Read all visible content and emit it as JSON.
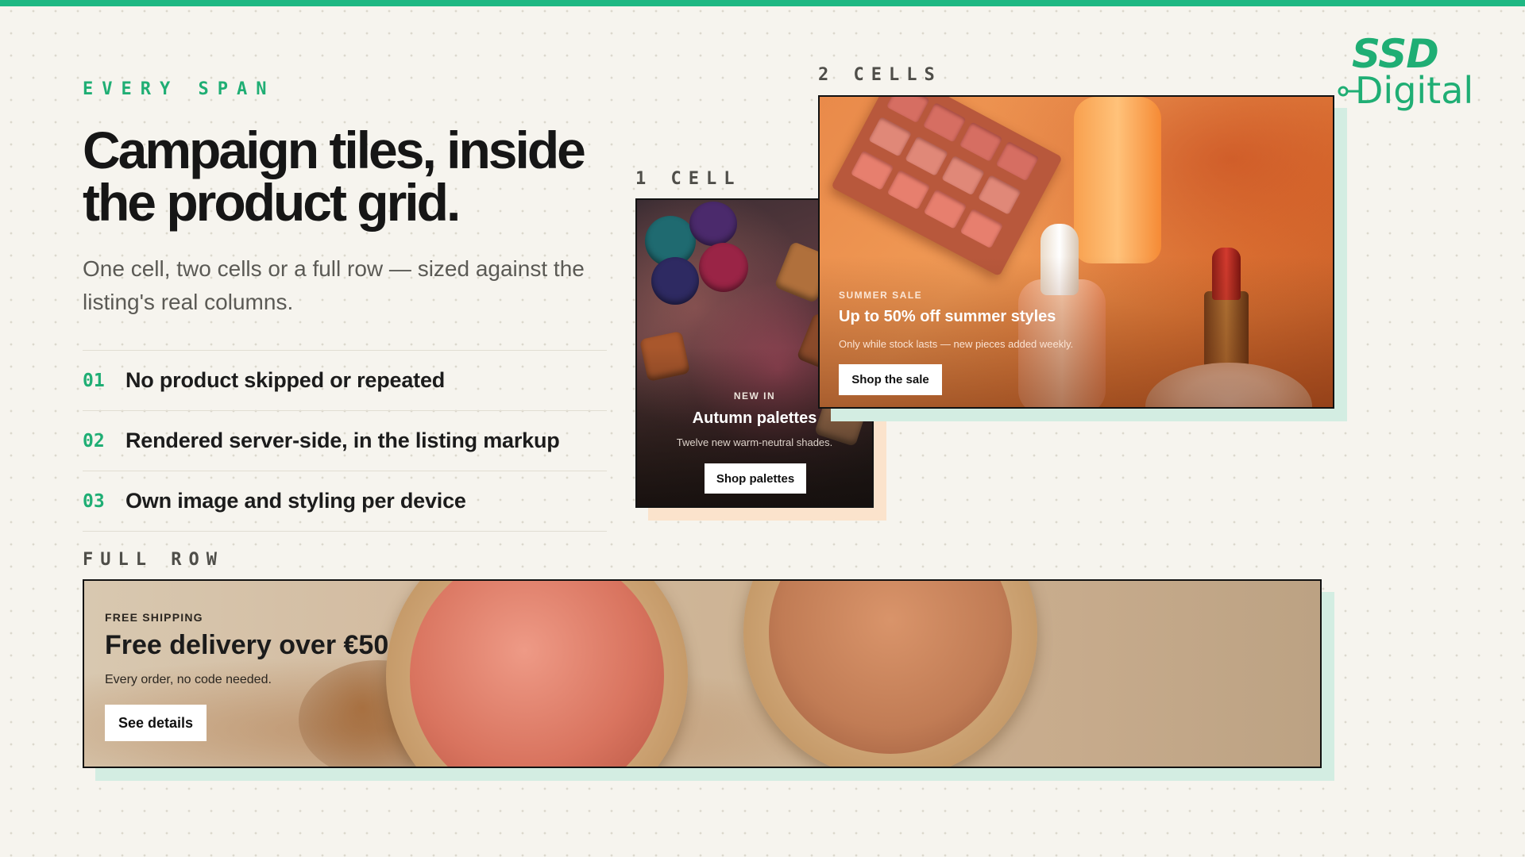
{
  "brand": {
    "logo_line1": "SSD",
    "logo_line2": "Digital",
    "accent_color": "#1fae74"
  },
  "hero": {
    "eyebrow": "EVERY SPAN",
    "headline": "Campaign tiles, inside the product grid.",
    "lede": "One cell, two cells or a full row — sized against the listing's real columns."
  },
  "features": [
    {
      "num": "01",
      "text": "No product skipped or repeated"
    },
    {
      "num": "02",
      "text": "Rendered server-side, in the listing markup"
    },
    {
      "num": "03",
      "text": "Own image and styling per device"
    }
  ],
  "labels": {
    "one_cell": "1 CELL",
    "two_cells": "2 CELLS",
    "full_row": "FULL ROW"
  },
  "tiles": {
    "one_cell": {
      "eyebrow": "NEW IN",
      "title": "Autumn palettes",
      "subtitle": "Twelve new warm-neutral shades.",
      "button": "Shop palettes",
      "shadow_color": "#fbe3cc"
    },
    "two_cells": {
      "eyebrow": "SUMMER SALE",
      "title": "Up to 50% off summer styles",
      "subtitle": "Only while stock lasts — new pieces added weekly.",
      "button": "Shop the sale",
      "shadow_color": "#d3ede2"
    },
    "full_row": {
      "eyebrow": "FREE SHIPPING",
      "title": "Free delivery over €50",
      "subtitle": "Every order, no code needed.",
      "button": "See details",
      "shadow_color": "#d3ede2"
    }
  }
}
